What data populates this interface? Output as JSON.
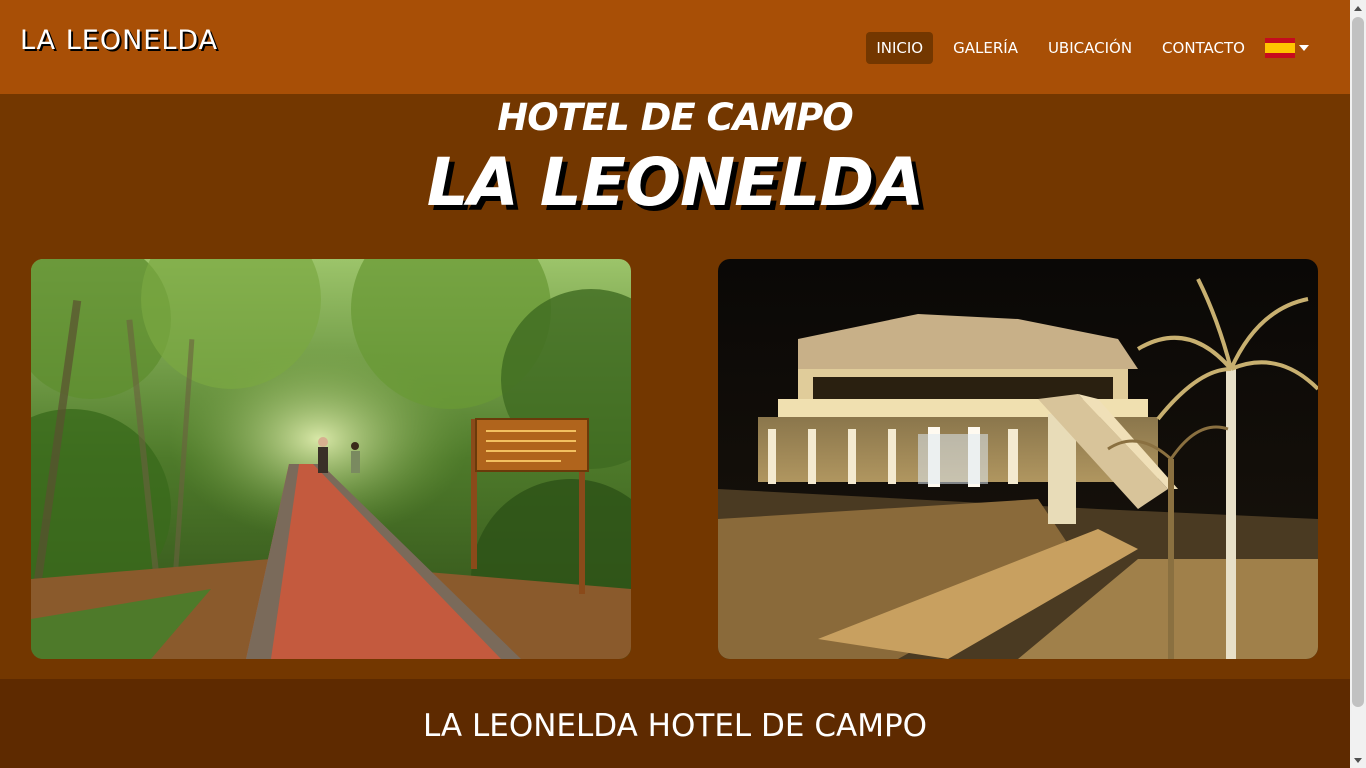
{
  "navbar": {
    "brand": "LA LEONELDA",
    "items": [
      {
        "label": "INICIO",
        "active": true
      },
      {
        "label": "GALERÍA",
        "active": false
      },
      {
        "label": "UBICACIÓN",
        "active": false
      },
      {
        "label": "CONTACTO",
        "active": false
      }
    ],
    "language_icon": "spain-flag-icon"
  },
  "hero": {
    "subtitle": "HOTEL DE CAMPO",
    "title": "LA LEONELDA",
    "photos": [
      {
        "name": "forest-path-photo"
      },
      {
        "name": "hotel-night-photo"
      }
    ]
  },
  "section": {
    "title": "LA LEONELDA HOTEL DE CAMPO"
  },
  "colors": {
    "navbar": "#a84f06",
    "hero_bg": "#733700",
    "active_nav_bg": "#733700",
    "section_bg": "#5e2a00"
  }
}
